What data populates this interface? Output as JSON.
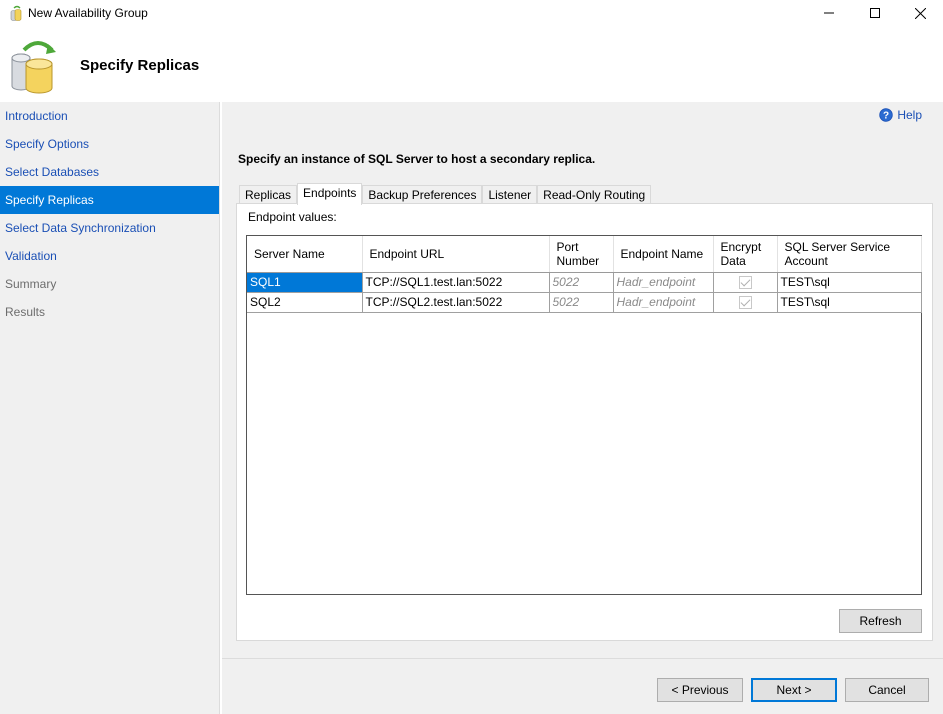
{
  "window": {
    "title": "New Availability Group"
  },
  "header": {
    "title": "Specify Replicas"
  },
  "sidebar": {
    "items": [
      {
        "label": "Introduction"
      },
      {
        "label": "Specify Options"
      },
      {
        "label": "Select Databases"
      },
      {
        "label": "Specify Replicas"
      },
      {
        "label": "Select Data Synchronization"
      },
      {
        "label": "Validation"
      },
      {
        "label": "Summary"
      },
      {
        "label": "Results"
      }
    ]
  },
  "help": {
    "label": "Help"
  },
  "instruction": "Specify an instance of SQL Server to host a secondary replica.",
  "tabs": [
    {
      "label": "Replicas"
    },
    {
      "label": "Endpoints"
    },
    {
      "label": "Backup Preferences"
    },
    {
      "label": "Listener"
    },
    {
      "label": "Read-Only Routing"
    }
  ],
  "endpoints": {
    "caption": "Endpoint values:",
    "columns": [
      "Server Name",
      "Endpoint URL",
      "Port Number",
      "Endpoint Name",
      "Encrypt Data",
      "SQL Server Service Account"
    ],
    "rows": [
      {
        "server": "SQL1",
        "url": "TCP://SQL1.test.lan:5022",
        "port": "5022",
        "endpoint": "Hadr_endpoint",
        "account": "TEST\\sql"
      },
      {
        "server": "SQL2",
        "url": "TCP://SQL2.test.lan:5022",
        "port": "5022",
        "endpoint": "Hadr_endpoint",
        "account": "TEST\\sql"
      }
    ],
    "refresh_label": "Refresh"
  },
  "footer": {
    "previous_label": "< Previous",
    "next_label": "Next >",
    "cancel_label": "Cancel"
  },
  "colors": {
    "accent": "#0078d7",
    "link": "#1a4fb5",
    "panel_bg": "#f0f0f0"
  }
}
